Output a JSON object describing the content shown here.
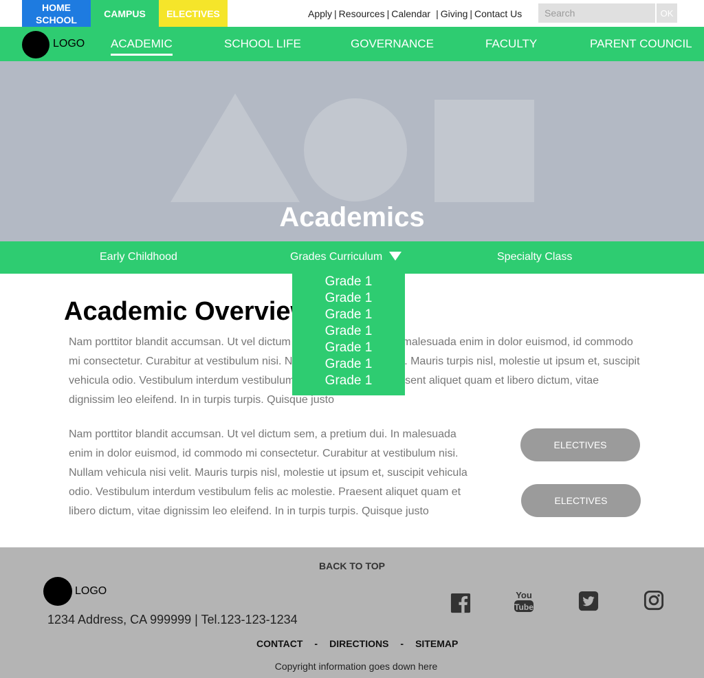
{
  "top_tabs": {
    "home_school": "HOME SCHOOL",
    "campus": "CAMPUS",
    "electives": "ELECTIVES"
  },
  "utility_links": [
    "Apply",
    "Resources",
    "Calendar",
    "Giving",
    "Contact Us"
  ],
  "search": {
    "placeholder": "Search",
    "button": "OK"
  },
  "logo": {
    "text": "LOGO"
  },
  "main_nav": [
    "ACADEMIC",
    "SCHOOL LIFE",
    "GOVERNANCE",
    "FACULTY",
    "PARENT COUNCIL"
  ],
  "main_nav_active": "ACADEMIC",
  "hero": {
    "title": "Academics"
  },
  "sub_nav": {
    "early_childhood": "Early Childhood",
    "grades_curriculum": "Grades Curriculum",
    "specialty_class": "Specialty Class"
  },
  "dropdown": [
    "Grade 1",
    "Grade 1",
    "Grade 1",
    "Grade 1",
    "Grade 1",
    "Grade 1",
    "Grade 1"
  ],
  "content": {
    "title": "Academic Overview",
    "paragraph1": "Nam porttitor blandit accumsan. Ut vel dictum sem, a pretium dui. In malesuada enim in dolor euismod, id commodo mi consectetur. Curabitur at vestibulum nisi. Nullam vehicula nisi velit. Mauris turpis nisl, molestie ut ipsum et, suscipit vehicula odio. Vestibulum interdum vestibulum felis ac molestie. Praesent aliquet quam et libero dictum, vitae dignissim leo eleifend. In in turpis turpis. Quisque justo",
    "paragraph2": "Nam porttitor blandit accumsan. Ut vel dictum sem, a pretium dui. In malesuada enim in dolor euismod, id commodo mi consectetur. Curabitur at vestibulum nisi. Nullam vehicula nisi velit. Mauris turpis nisl, molestie ut ipsum et, suscipit vehicula odio. Vestibulum interdum vestibulum felis ac molestie. Praesent aliquet quam et libero dictum, vitae dignissim leo eleifend. In in turpis turpis. Quisque justo",
    "button1": "ELECTIVES",
    "button2": "ELECTIVES"
  },
  "footer": {
    "back_to_top": "BACK TO TOP",
    "logo_text": "LOGO",
    "address": "1234 Address, CA 999999 |  Tel.123-123-1234",
    "links": [
      "CONTACT",
      "DIRECTIONS",
      "SITEMAP"
    ],
    "copyright": "Copyright information goes down here",
    "social": [
      "facebook-icon",
      "youtube-icon",
      "twitter-icon",
      "instagram-icon"
    ]
  },
  "colors": {
    "brand_green": "#2ecc71",
    "home_blue": "#1e7be0",
    "electives_yellow": "#f5e52a",
    "hero_gray": "#b3b9c4",
    "footer_gray": "#b4b4b4",
    "pill_gray": "#9b9b9b"
  }
}
